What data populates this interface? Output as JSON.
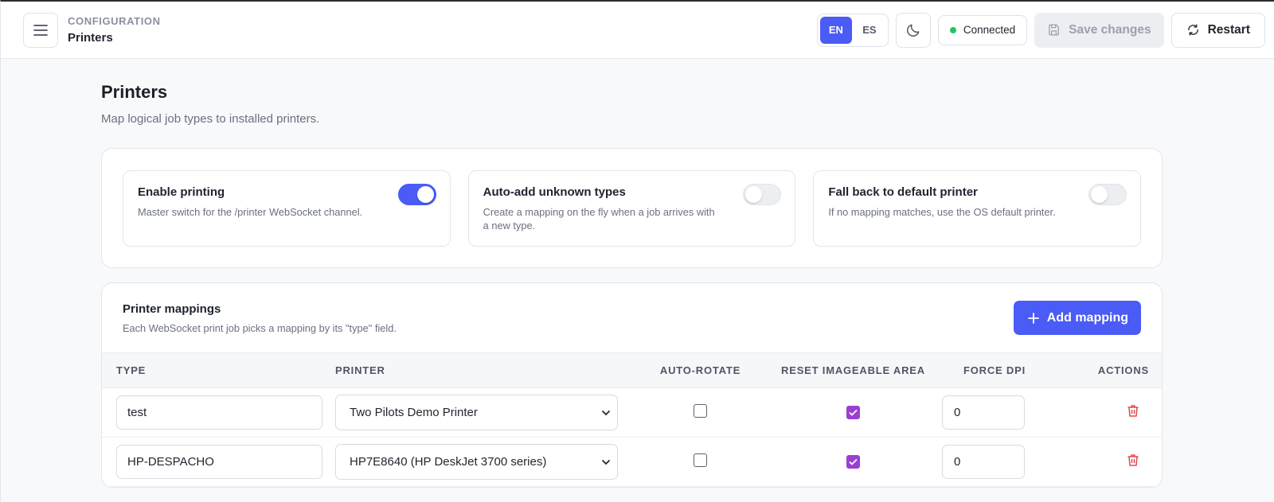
{
  "header": {
    "breadcrumb_top": "CONFIGURATION",
    "breadcrumb_title": "Printers",
    "languages": [
      "EN",
      "ES"
    ],
    "active_language": "EN",
    "status": "Connected",
    "save_label": "Save changes",
    "restart_label": "Restart"
  },
  "page": {
    "title": "Printers",
    "subtitle": "Map logical job types to installed printers."
  },
  "toggles": [
    {
      "title": "Enable printing",
      "desc": "Master switch for the /printer WebSocket channel.",
      "on": true
    },
    {
      "title": "Auto-add unknown types",
      "desc": "Create a mapping on the fly when a job arrives with a new type.",
      "on": false
    },
    {
      "title": "Fall back to default printer",
      "desc": "If no mapping matches, use the OS default printer.",
      "on": false
    }
  ],
  "mappings": {
    "title": "Printer mappings",
    "subtitle": "Each WebSocket print job picks a mapping by its \"type\" field.",
    "add_label": "Add mapping",
    "columns": [
      "TYPE",
      "PRINTER",
      "AUTO-ROTATE",
      "RESET IMAGEABLE AREA",
      "FORCE DPI",
      "ACTIONS"
    ],
    "rows": [
      {
        "type": "test",
        "printer": "Two Pilots Demo Printer",
        "auto_rotate": false,
        "reset_area": true,
        "dpi": "0"
      },
      {
        "type": "HP-DESPACHO",
        "printer": "HP7E8640 (HP DeskJet 3700 series)",
        "auto_rotate": false,
        "reset_area": true,
        "dpi": "0"
      }
    ]
  },
  "colors": {
    "accent": "#4a5bf6",
    "checkbox": "#9a3fd1",
    "status_dot": "#22c55e",
    "delete": "#e5484d"
  }
}
